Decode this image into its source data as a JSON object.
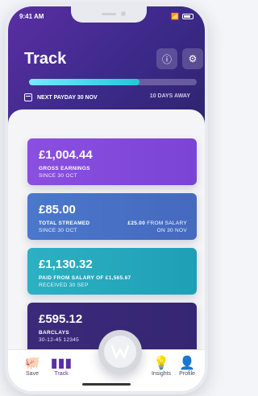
{
  "status_bar": {
    "time": "9:41 AM"
  },
  "header": {
    "title": "Track",
    "next_payday": "NEXT PAYDAY 30 NOV",
    "days_away": "10 DAYS AWAY",
    "progress_fraction": 0.66,
    "colors": {
      "brand": "#5b2ea3",
      "accent": "#24c7d8"
    }
  },
  "cards": [
    {
      "amount": "£1,004.44",
      "label": "GROSS EARNINGS",
      "sub": "SINCE 30 OCT",
      "color": "#8b4fe0"
    },
    {
      "amount": "£85.00",
      "label": "TOTAL STREAMED",
      "sub": "SINCE 30 OCT",
      "right_value": "£25.00",
      "right_text": "FROM SALARY",
      "right_sub": "ON 30 NOV",
      "color": "#4b78cc"
    },
    {
      "amount": "£1,130.32",
      "label": "PAID FROM SALARY OF £1,565.67",
      "sub": "RECEIVED 30 SEP",
      "color": "#2db0c3"
    },
    {
      "amount": "£595.12",
      "label": "BARCLAYS",
      "sub": "30-12-45 12345",
      "color": "#3b2a7a"
    }
  ],
  "tabbar": {
    "items": [
      {
        "label": "Save",
        "icon": "piggy-bank-icon"
      },
      {
        "label": "Track",
        "icon": "bar-chart-icon"
      },
      {
        "label": "Insights",
        "icon": "lightbulb-icon"
      },
      {
        "label": "Profile",
        "icon": "person-icon"
      }
    ],
    "fab_icon": "w-logo-icon"
  }
}
